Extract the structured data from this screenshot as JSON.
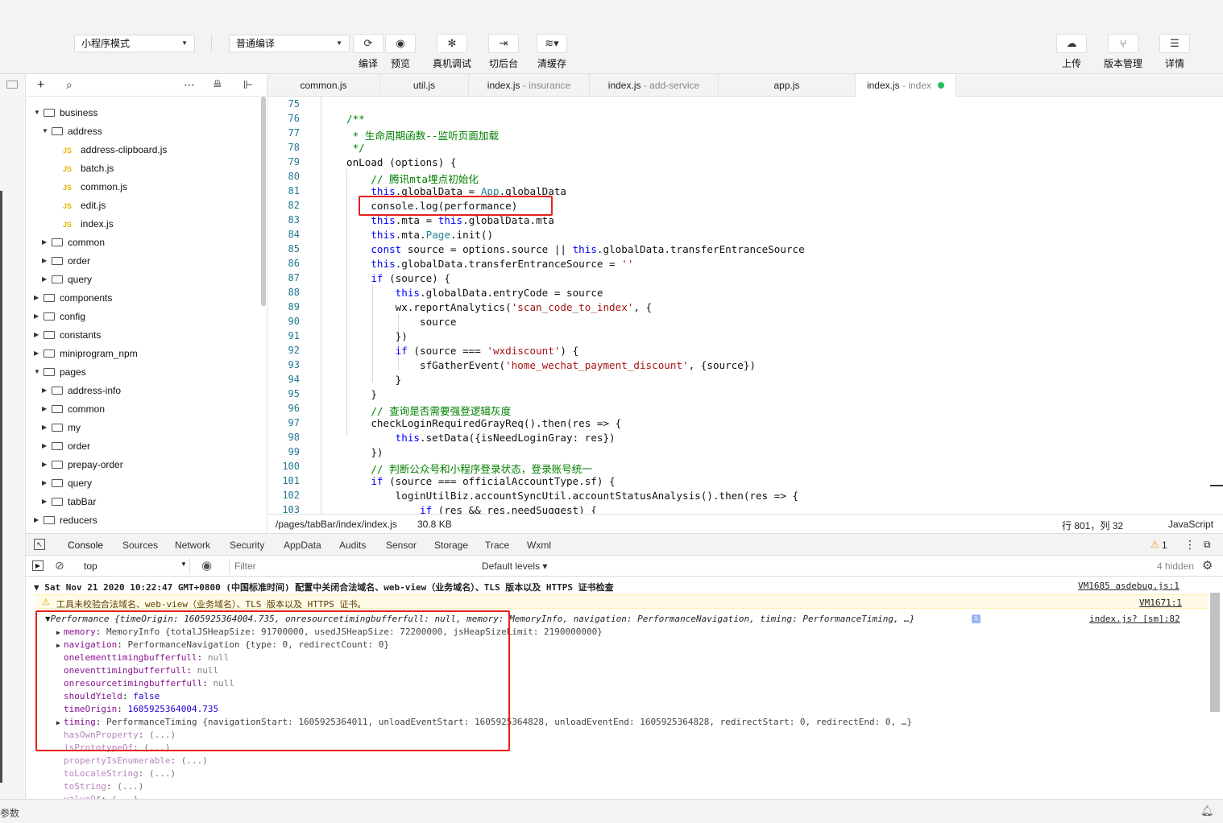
{
  "toolbar": {
    "mode_select": "小程序模式",
    "compile_select": "普通编译",
    "buttons": [
      {
        "label": "编译",
        "icon": "refresh-icon"
      },
      {
        "label": "预览",
        "icon": "eye-icon"
      },
      {
        "label": "真机调试",
        "icon": "bug-icon"
      },
      {
        "label": "切后台",
        "icon": "switch-icon"
      },
      {
        "label": "清缓存",
        "icon": "layers-icon"
      }
    ],
    "right_buttons": [
      {
        "label": "上传",
        "icon": "cloud-upload-icon"
      },
      {
        "label": "版本管理",
        "icon": "branch-icon"
      },
      {
        "label": "详情",
        "icon": "menu-icon"
      }
    ]
  },
  "explorer": {
    "tree": [
      {
        "label": "business",
        "kind": "folder",
        "open": true,
        "depth": 0
      },
      {
        "label": "address",
        "kind": "folder",
        "open": true,
        "depth": 1
      },
      {
        "label": "address-clipboard.js",
        "kind": "js",
        "depth": 2
      },
      {
        "label": "batch.js",
        "kind": "js",
        "depth": 2
      },
      {
        "label": "common.js",
        "kind": "js",
        "depth": 2
      },
      {
        "label": "edit.js",
        "kind": "js",
        "depth": 2
      },
      {
        "label": "index.js",
        "kind": "js",
        "depth": 2
      },
      {
        "label": "common",
        "kind": "folder",
        "open": false,
        "depth": 1
      },
      {
        "label": "order",
        "kind": "folder",
        "open": false,
        "depth": 1
      },
      {
        "label": "query",
        "kind": "folder",
        "open": false,
        "depth": 1
      },
      {
        "label": "components",
        "kind": "folder",
        "open": false,
        "depth": 0
      },
      {
        "label": "config",
        "kind": "folder",
        "open": false,
        "depth": 0
      },
      {
        "label": "constants",
        "kind": "folder",
        "open": false,
        "depth": 0
      },
      {
        "label": "miniprogram_npm",
        "kind": "folder",
        "open": false,
        "depth": 0
      },
      {
        "label": "pages",
        "kind": "folder",
        "open": true,
        "depth": 0
      },
      {
        "label": "address-info",
        "kind": "folder",
        "open": false,
        "depth": 1
      },
      {
        "label": "common",
        "kind": "folder",
        "open": false,
        "depth": 1
      },
      {
        "label": "my",
        "kind": "folder",
        "open": false,
        "depth": 1
      },
      {
        "label": "order",
        "kind": "folder",
        "open": false,
        "depth": 1
      },
      {
        "label": "prepay-order",
        "kind": "folder",
        "open": false,
        "depth": 1
      },
      {
        "label": "query",
        "kind": "folder",
        "open": false,
        "depth": 1
      },
      {
        "label": "tabBar",
        "kind": "folder",
        "open": false,
        "depth": 1
      },
      {
        "label": "reducers",
        "kind": "folder",
        "open": false,
        "depth": 0
      }
    ]
  },
  "tabs": [
    {
      "name": "common.js",
      "dir": ""
    },
    {
      "name": "util.js",
      "dir": ""
    },
    {
      "name": "index.js",
      "dir": " - insurance"
    },
    {
      "name": "index.js",
      "dir": " - add-service"
    },
    {
      "name": "app.js",
      "dir": ""
    },
    {
      "name": "index.js",
      "dir": " - index",
      "active": true
    }
  ],
  "editor": {
    "lines": [
      {
        "n": "75",
        "t": ""
      },
      {
        "n": "76",
        "t": "/**"
      },
      {
        "n": "77",
        "t": " * 生命周期函数--监听页面加载"
      },
      {
        "n": "78",
        "t": " */"
      },
      {
        "n": "79",
        "t": "onLoad (options) {"
      },
      {
        "n": "80",
        "t": "    // 腾讯mta埋点初始化"
      },
      {
        "n": "81",
        "t": "    this.globalData = App.globalData"
      },
      {
        "n": "82",
        "t": "    console.log(performance)"
      },
      {
        "n": "83",
        "t": "    this.mta = this.globalData.mta"
      },
      {
        "n": "84",
        "t": "    this.mta.Page.init()"
      },
      {
        "n": "85",
        "t": "    const source = options.source || this.globalData.transferEntranceSource"
      },
      {
        "n": "86",
        "t": "    this.globalData.transferEntranceSource = ''"
      },
      {
        "n": "87",
        "t": "    if (source) {"
      },
      {
        "n": "88",
        "t": "        this.globalData.entryCode = source"
      },
      {
        "n": "89",
        "t": "        wx.reportAnalytics('scan_code_to_index', {"
      },
      {
        "n": "90",
        "t": "            source"
      },
      {
        "n": "91",
        "t": "        })"
      },
      {
        "n": "92",
        "t": "        if (source === 'wxdiscount') {"
      },
      {
        "n": "93",
        "t": "            sfGatherEvent('home_wechat_payment_discount', {source})"
      },
      {
        "n": "94",
        "t": "        }"
      },
      {
        "n": "95",
        "t": "    }"
      },
      {
        "n": "96",
        "t": "    // 查询是否需要强登逻辑灰度"
      },
      {
        "n": "97",
        "t": "    checkLoginRequiredGrayReq().then(res => {"
      },
      {
        "n": "98",
        "t": "        this.setData({isNeedLoginGray: res})"
      },
      {
        "n": "99",
        "t": "    })"
      },
      {
        "n": "100",
        "t": "    // 判断公众号和小程序登录状态，登录账号统一"
      },
      {
        "n": "101",
        "t": "    if (source === officialAccountType.sf) {"
      },
      {
        "n": "102",
        "t": "        loginUtilBiz.accountSyncUtil.accountStatusAnalysis().then(res => {"
      },
      {
        "n": "103",
        "t": "            if (res && res.needSuggest) {"
      }
    ]
  },
  "status": {
    "path": "/pages/tabBar/index/index.js",
    "size": "30.8 KB",
    "position": "行 801，列 32",
    "language": "JavaScript"
  },
  "devtools": {
    "tabs": [
      "Console",
      "Sources",
      "Network",
      "Security",
      "AppData",
      "Audits",
      "Sensor",
      "Storage",
      "Trace",
      "Wxml"
    ],
    "active_tab": "Console",
    "warn_count": "1",
    "context": "top",
    "filter_placeholder": "Filter",
    "levels": "Default levels ▾",
    "hidden": "4 hidden"
  },
  "console": {
    "group_header": "Sat Nov 21 2020 10:22:47 GMT+0800 (中国标准时间) 配置中关闭合法域名、web-view（业务域名）、TLS 版本以及 HTTPS 证书检查",
    "group_link": "VM1685 asdebug.js:1",
    "warning": "工具未校验合法域名、web-view（业务域名）、TLS 版本以及 HTTPS 证书。",
    "warning_link": "VM1671:1",
    "perf_summary": "Performance {timeOrigin: 1605925364004.735, onresourcetimingbufferfull: null, memory: MemoryInfo, navigation: PerformanceNavigation, timing: PerformanceTiming, …}",
    "perf_link": "index.js? [sm]:82",
    "rows": [
      {
        "arrow": "▶",
        "key": "memory",
        "val": "MemoryInfo {totalJSHeapSize: 91700000, usedJSHeapSize: 72200000, jsHeapSizeLimit: 2190000000}"
      },
      {
        "arrow": "▶",
        "key": "navigation",
        "val": "PerformanceNavigation {type: 0, redirectCount: 0}"
      },
      {
        "arrow": "",
        "key": "onelementtimingbufferfull",
        "val": "null"
      },
      {
        "arrow": "",
        "key": "oneventtimingbufferfull",
        "val": "null"
      },
      {
        "arrow": "",
        "key": "onresourcetimingbufferfull",
        "val": "null"
      },
      {
        "arrow": "",
        "key": "shouldYield",
        "val": "false"
      },
      {
        "arrow": "",
        "key": "timeOrigin",
        "val": "1605925364004.735"
      },
      {
        "arrow": "▶",
        "key": "timing",
        "val": "PerformanceTiming {navigationStart: 1605925364011, unloadEventStart: 1605925364828, unloadEventEnd: 1605925364828, redirectStart: 0, redirectEnd: 0, …}"
      },
      {
        "arrow": "",
        "key": "hasOwnProperty",
        "val": "(...)",
        "faded": true
      },
      {
        "arrow": "",
        "key": "isPrototypeOf",
        "val": "(...)",
        "faded": true
      },
      {
        "arrow": "",
        "key": "propertyIsEnumerable",
        "val": "(...)",
        "faded": true
      },
      {
        "arrow": "",
        "key": "toLocaleString",
        "val": "(...)",
        "faded": true
      },
      {
        "arrow": "",
        "key": "toString",
        "val": "(...)",
        "faded": true
      },
      {
        "arrow": "",
        "key": "valueOf",
        "val": "(...)",
        "faded": true
      }
    ]
  },
  "bottom": {
    "left_text": "参数"
  },
  "colors": {
    "highlight": "#e8211c",
    "accent_dot": "#20c05c",
    "keyword": "#0000ff",
    "string": "#a31515",
    "comment": "#008000"
  }
}
